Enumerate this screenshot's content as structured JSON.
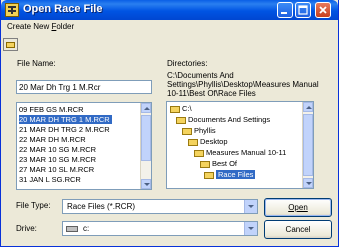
{
  "window": {
    "title": "Open Race File",
    "colors": {
      "titlebar": "#0054e3",
      "selection": "#316ac5",
      "face": "#ece9d8"
    }
  },
  "menu": {
    "create_new_folder_pre": "Create New ",
    "create_new_folder_mnemonic": "F",
    "create_new_folder_post": "older"
  },
  "file_name": {
    "label": "File Name:",
    "value": "20 Mar Dh Trg 1 M.Rcr",
    "list": [
      "09 FEB GS M.RCR",
      "20 MAR DH TRG 1 M.RCR",
      "21 MAR DH TRG 2 M.RCR",
      "22 MAR DH M.RCR",
      "22 MAR 10 SG M.RCR",
      "23 MAR 10 SG M.RCR",
      "27 MAR 10 SL M.RCR",
      "31 JAN L SG.RCR"
    ],
    "selected_index": 1
  },
  "directories": {
    "label": "Directories:",
    "path_line1": "C:\\Documents And",
    "path_line2": "Settings\\Phyllis\\Desktop\\Measures Manual",
    "path_line3": "10-11\\Best Of\\Race Files",
    "tree": [
      "C:\\",
      "Documents And Settings",
      "Phyllis",
      "Desktop",
      "Measures Manual 10-11",
      "Best Of",
      "Race Files"
    ],
    "selected_index": 6
  },
  "file_type": {
    "label": "File Type:",
    "value": "Race Files (*.RCR)"
  },
  "drive": {
    "label": "Drive:",
    "value": "c:"
  },
  "buttons": {
    "open": "Open",
    "cancel": "Cancel"
  },
  "icons": {
    "app": "race-app-icon",
    "new_folder": "new-folder-icon",
    "folder": "folder-icon",
    "drive": "hard-drive-icon"
  }
}
